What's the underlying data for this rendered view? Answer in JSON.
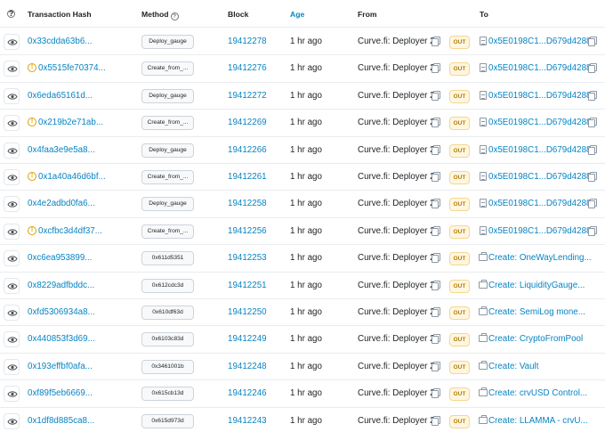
{
  "header": {
    "help_glyph": "?",
    "tx_hash": "Transaction Hash",
    "method": "Method",
    "block": "Block",
    "age": "Age",
    "from": "From",
    "to": "To"
  },
  "direction_label": "OUT",
  "rows": [
    {
      "hash": "0x33cdda63b6...",
      "warn": false,
      "method": "Deploy_gauge",
      "block": "19412278",
      "age": "1 hr ago",
      "from": "Curve.fi: Deployer 2",
      "to": "0x5E0198C1...D679d4288",
      "to_kind": "contract"
    },
    {
      "hash": "0x5515fe70374...",
      "warn": true,
      "method": "Create_from_...",
      "block": "19412276",
      "age": "1 hr ago",
      "from": "Curve.fi: Deployer 2",
      "to": "0x5E0198C1...D679d4288",
      "to_kind": "contract"
    },
    {
      "hash": "0x6eda65161d...",
      "warn": false,
      "method": "Deploy_gauge",
      "block": "19412272",
      "age": "1 hr ago",
      "from": "Curve.fi: Deployer 2",
      "to": "0x5E0198C1...D679d4288",
      "to_kind": "contract"
    },
    {
      "hash": "0x219b2e71ab...",
      "warn": true,
      "method": "Create_from_...",
      "block": "19412269",
      "age": "1 hr ago",
      "from": "Curve.fi: Deployer 2",
      "to": "0x5E0198C1...D679d4288",
      "to_kind": "contract"
    },
    {
      "hash": "0x4faa3e9e5a8...",
      "warn": false,
      "method": "Deploy_gauge",
      "block": "19412266",
      "age": "1 hr ago",
      "from": "Curve.fi: Deployer 2",
      "to": "0x5E0198C1...D679d4288",
      "to_kind": "contract"
    },
    {
      "hash": "0x1a40a46d6bf...",
      "warn": true,
      "method": "Create_from_...",
      "block": "19412261",
      "age": "1 hr ago",
      "from": "Curve.fi: Deployer 2",
      "to": "0x5E0198C1...D679d4288",
      "to_kind": "contract"
    },
    {
      "hash": "0x4e2adbd0fa6...",
      "warn": false,
      "method": "Deploy_gauge",
      "block": "19412258",
      "age": "1 hr ago",
      "from": "Curve.fi: Deployer 2",
      "to": "0x5E0198C1...D679d4288",
      "to_kind": "contract"
    },
    {
      "hash": "0xcfbc3d4df37...",
      "warn": true,
      "method": "Create_from_...",
      "block": "19412256",
      "age": "1 hr ago",
      "from": "Curve.fi: Deployer 2",
      "to": "0x5E0198C1...D679d4288",
      "to_kind": "contract"
    },
    {
      "hash": "0xc6ea953899...",
      "warn": false,
      "method": "0x611d5351",
      "block": "19412253",
      "age": "1 hr ago",
      "from": "Curve.fi: Deployer 2",
      "to": "Create: OneWayLending...",
      "to_kind": "create"
    },
    {
      "hash": "0x8229adfbddc...",
      "warn": false,
      "method": "0x612cdc3d",
      "block": "19412251",
      "age": "1 hr ago",
      "from": "Curve.fi: Deployer 2",
      "to": "Create: LiquidityGauge...",
      "to_kind": "create"
    },
    {
      "hash": "0xfd5306934a8...",
      "warn": false,
      "method": "0x610df63d",
      "block": "19412250",
      "age": "1 hr ago",
      "from": "Curve.fi: Deployer 2",
      "to": "Create: SemiLog mone...",
      "to_kind": "create"
    },
    {
      "hash": "0x440853f3d69...",
      "warn": false,
      "method": "0x6103c83d",
      "block": "19412249",
      "age": "1 hr ago",
      "from": "Curve.fi: Deployer 2",
      "to": "Create: CryptoFromPool",
      "to_kind": "create"
    },
    {
      "hash": "0x193effbf0afa...",
      "warn": false,
      "method": "0x3461001b",
      "block": "19412248",
      "age": "1 hr ago",
      "from": "Curve.fi: Deployer 2",
      "to": "Create: Vault",
      "to_kind": "create"
    },
    {
      "hash": "0xf89f5eb6669...",
      "warn": false,
      "method": "0x615cb13d",
      "block": "19412246",
      "age": "1 hr ago",
      "from": "Curve.fi: Deployer 2",
      "to": "Create: crvUSD Control...",
      "to_kind": "create"
    },
    {
      "hash": "0x1df8d885ca8...",
      "warn": false,
      "method": "0x615d973d",
      "block": "19412243",
      "age": "1 hr ago",
      "from": "Curve.fi: Deployer 2",
      "to": "Create: LLAMMA - crvU...",
      "to_kind": "create"
    }
  ]
}
